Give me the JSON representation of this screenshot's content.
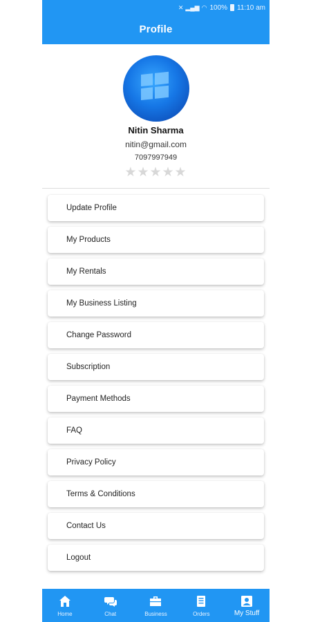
{
  "status_bar": {
    "battery": "100%",
    "time": "11:10 am"
  },
  "header": {
    "title": "Profile"
  },
  "profile": {
    "name": "Nitin Sharma",
    "email": "nitin@gmail.com",
    "phone": "7097997949",
    "rating_filled": 0,
    "rating_max": 5,
    "rating_display": "★★★★★"
  },
  "menu": {
    "items": [
      {
        "label": "Update Profile"
      },
      {
        "label": "My Products"
      },
      {
        "label": "My Rentals"
      },
      {
        "label": "My Business Listing"
      },
      {
        "label": "Change Password"
      },
      {
        "label": "Subscription"
      },
      {
        "label": "Payment Methods"
      },
      {
        "label": "FAQ"
      },
      {
        "label": "Privacy Policy"
      },
      {
        "label": "Terms & Conditions"
      },
      {
        "label": "Contact Us"
      },
      {
        "label": "Logout"
      }
    ]
  },
  "bottom_nav": {
    "items": [
      {
        "label": "Home",
        "icon": "home-icon"
      },
      {
        "label": "Chat",
        "icon": "chat-icon"
      },
      {
        "label": "Business",
        "icon": "briefcase-icon"
      },
      {
        "label": "Orders",
        "icon": "orders-icon"
      },
      {
        "label": "My Stuff",
        "icon": "person-icon",
        "active": true
      }
    ]
  },
  "colors": {
    "primary": "#2196f3",
    "star_empty": "#d8d8d8"
  }
}
